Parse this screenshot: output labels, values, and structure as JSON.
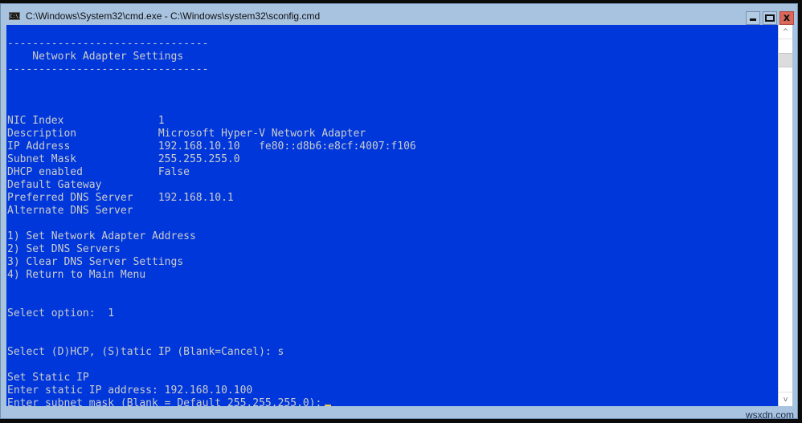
{
  "window": {
    "title": "C:\\Windows\\System32\\cmd.exe - C:\\Windows\\system32\\sconfig.cmd",
    "icon": "cmd-icon",
    "icon_text": "C:\\.",
    "controls": {
      "minimize": "minimize-icon",
      "maximize": "maximize-icon",
      "close": "close-icon",
      "close_glyph": "x"
    }
  },
  "console": {
    "background": "#0037da",
    "foreground": "#cccccc",
    "cursor_color": "#f2c94c",
    "lines": [
      "",
      "--------------------------------",
      "    Network Adapter Settings",
      "--------------------------------",
      "",
      "",
      "",
      "NIC Index               1",
      "Description             Microsoft Hyper-V Network Adapter",
      "IP Address              192.168.10.10   fe80::d8b6:e8cf:4007:f106",
      "Subnet Mask             255.255.255.0",
      "DHCP enabled            False",
      "Default Gateway",
      "Preferred DNS Server    192.168.10.1",
      "Alternate DNS Server",
      "",
      "1) Set Network Adapter Address",
      "2) Set DNS Servers",
      "3) Clear DNS Server Settings",
      "4) Return to Main Menu",
      "",
      "",
      "Select option:  1",
      "",
      "",
      "Select (D)HCP, (S)tatic IP (Blank=Cancel): s",
      "",
      "Set Static IP",
      "Enter static IP address: 192.168.10.100",
      "Enter subnet mask (Blank = Default 255.255.255.0):"
    ]
  },
  "scrollbar": {
    "up": "chevron-up-icon",
    "down": "chevron-down-icon",
    "up_glyph": "^",
    "down_glyph": "v"
  },
  "watermark": "wsxdn.com"
}
